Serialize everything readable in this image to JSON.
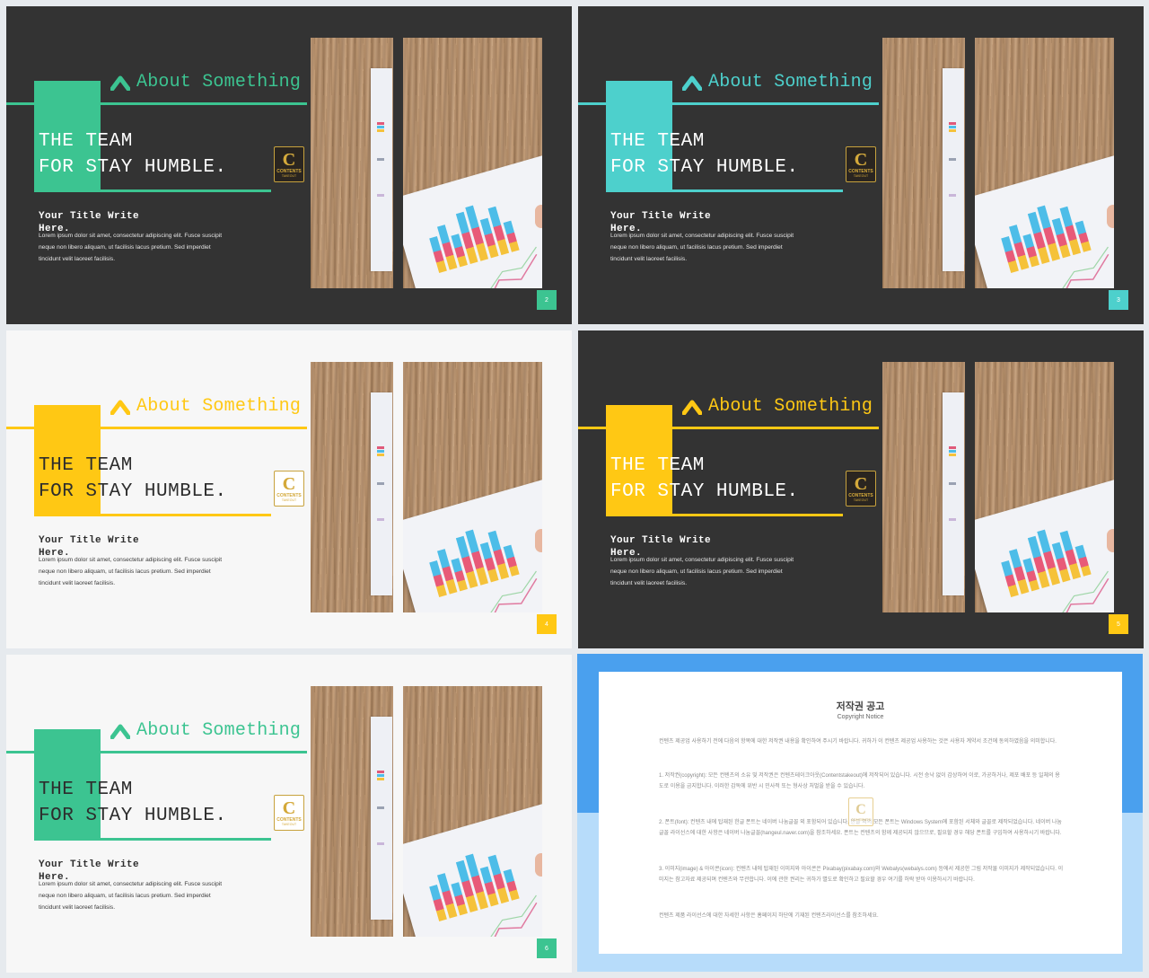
{
  "colors": {
    "green": "#3cc491",
    "teal": "#4dd0cc",
    "yellow": "#ffc814",
    "dark_bg": "#333333",
    "light_bg": "#f7f7f7",
    "copyright_blue": "#4aa0ee",
    "copyright_light_blue": "#b7dcfa"
  },
  "logo": {
    "letter": "C",
    "line1": "CONTENTS",
    "line2": "TAKEOUT"
  },
  "slides": [
    {
      "page": "2",
      "accent": "#3cc491",
      "theme": "dark",
      "about": "About Something",
      "headline1": "THE TEAM",
      "headline2": "FOR STAY HUMBLE.",
      "subtitle": "Your Title Write Here.",
      "body": "Lorem ipsum dolor sit amet, consectetur adipiscing elit. Fusce suscipit neque non libero aliquam, ut facilisis lacus pretium. Sed imperdiet tincidunt velit laoreet facilisis."
    },
    {
      "page": "3",
      "accent": "#4dd0cc",
      "theme": "dark",
      "about": "About Something",
      "headline1": "THE TEAM",
      "headline2": "FOR STAY HUMBLE.",
      "subtitle": "Your Title Write Here.",
      "body": "Lorem ipsum dolor sit amet, consectetur adipiscing elit. Fusce suscipit neque non libero aliquam, ut facilisis lacus pretium. Sed imperdiet tincidunt velit laoreet facilisis."
    },
    {
      "page": "4",
      "accent": "#ffc814",
      "theme": "light",
      "about": "About Something",
      "headline1": "THE TEAM",
      "headline2": "FOR STAY HUMBLE.",
      "subtitle": "Your Title Write Here.",
      "body": "Lorem ipsum dolor sit amet, consectetur adipiscing elit. Fusce suscipit neque non libero aliquam, ut facilisis lacus pretium. Sed imperdiet tincidunt velit laoreet facilisis."
    },
    {
      "page": "5",
      "accent": "#ffc814",
      "theme": "dark",
      "about": "About Something",
      "headline1": "THE TEAM",
      "headline2": "FOR STAY HUMBLE.",
      "subtitle": "Your Title Write Here.",
      "body": "Lorem ipsum dolor sit amet, consectetur adipiscing elit. Fusce suscipit neque non libero aliquam, ut facilisis lacus pretium. Sed imperdiet tincidunt velit laoreet facilisis."
    },
    {
      "page": "6",
      "accent": "#3cc491",
      "theme": "light",
      "about": "About Something",
      "headline1": "THE TEAM",
      "headline2": "FOR STAY HUMBLE.",
      "subtitle": "Your Title Write Here.",
      "body": "Lorem ipsum dolor sit amet, consectetur adipiscing elit. Fusce suscipit neque non libero aliquam, ut facilisis lacus pretium. Sed imperdiet tincidunt velit laoreet facilisis."
    }
  ],
  "copyright": {
    "title": "저작권 공고",
    "subtitle": "Copyright Notice",
    "p0": "컨텐츠 제공업 사용하기 전에 다음의 항목에 대한 저작권 내용을 확인하여 주시기 바랍니다. 귀하가 이 컨텐츠 제공업 사용하는 것은 사용자 계약서 조건에 동의하였음을 의미합니다.",
    "p1": "1. 저작권(copyright): 모든 컨텐츠의 소유 및 저작권은 컨텐츠테이크아웃(Contentstakeout)에 저작되어 있습니다. 시전 승낙 없이 감상하여 이로, 가공하거나, 제포 배포 등 일체의 용도로 이용을 금지합니다. 이러한 감독에 위반 시 민사적 또는 형사상 처벌을 받을 수 있습니다.",
    "p2": "2. 폰트(font): 컨텐츠 내에 탑재된 한글 폰트는 네이버 나눔글꼴 외 포함되어 있습니다. 한글 외의 모든 폰트는 Windows System에 포함된 서체와 글꼴로 제작되었습니다. 네이버 나눔글꼴 라이선스에 대한 사항은 네이버 나눔글꼴(hangeul.naver.com)을 참조하세요. 폰트는 컨텐츠의 함께 제공되지 않으므로, 필요할 경우 해당 폰트를 구입하여 사용하시기 바랍니다.",
    "p3": "3. 이미지(image) & 아이콘(icon): 컨텐츠 내에 탑재된 이미지와 아이콘은 Pixabay(pixabay.com)와 Webalys(webalys.com) 등에서 제공한 그림 저작물 이미지가 제작되었습니다. 이미지는 참고자료 제공되며 컨텐츠와 무관합니다. 이에 관한 권리는 귀하가 별도로 확인하고 필요할 경우 여기를 허락 받아 이용하시기 바랍니다.",
    "p4": "컨텐츠 제품 라이선스에 대한 자세한 사항은 홈페이지 하단에 기재된 컨텐츠라이선스를 참조하세요."
  }
}
